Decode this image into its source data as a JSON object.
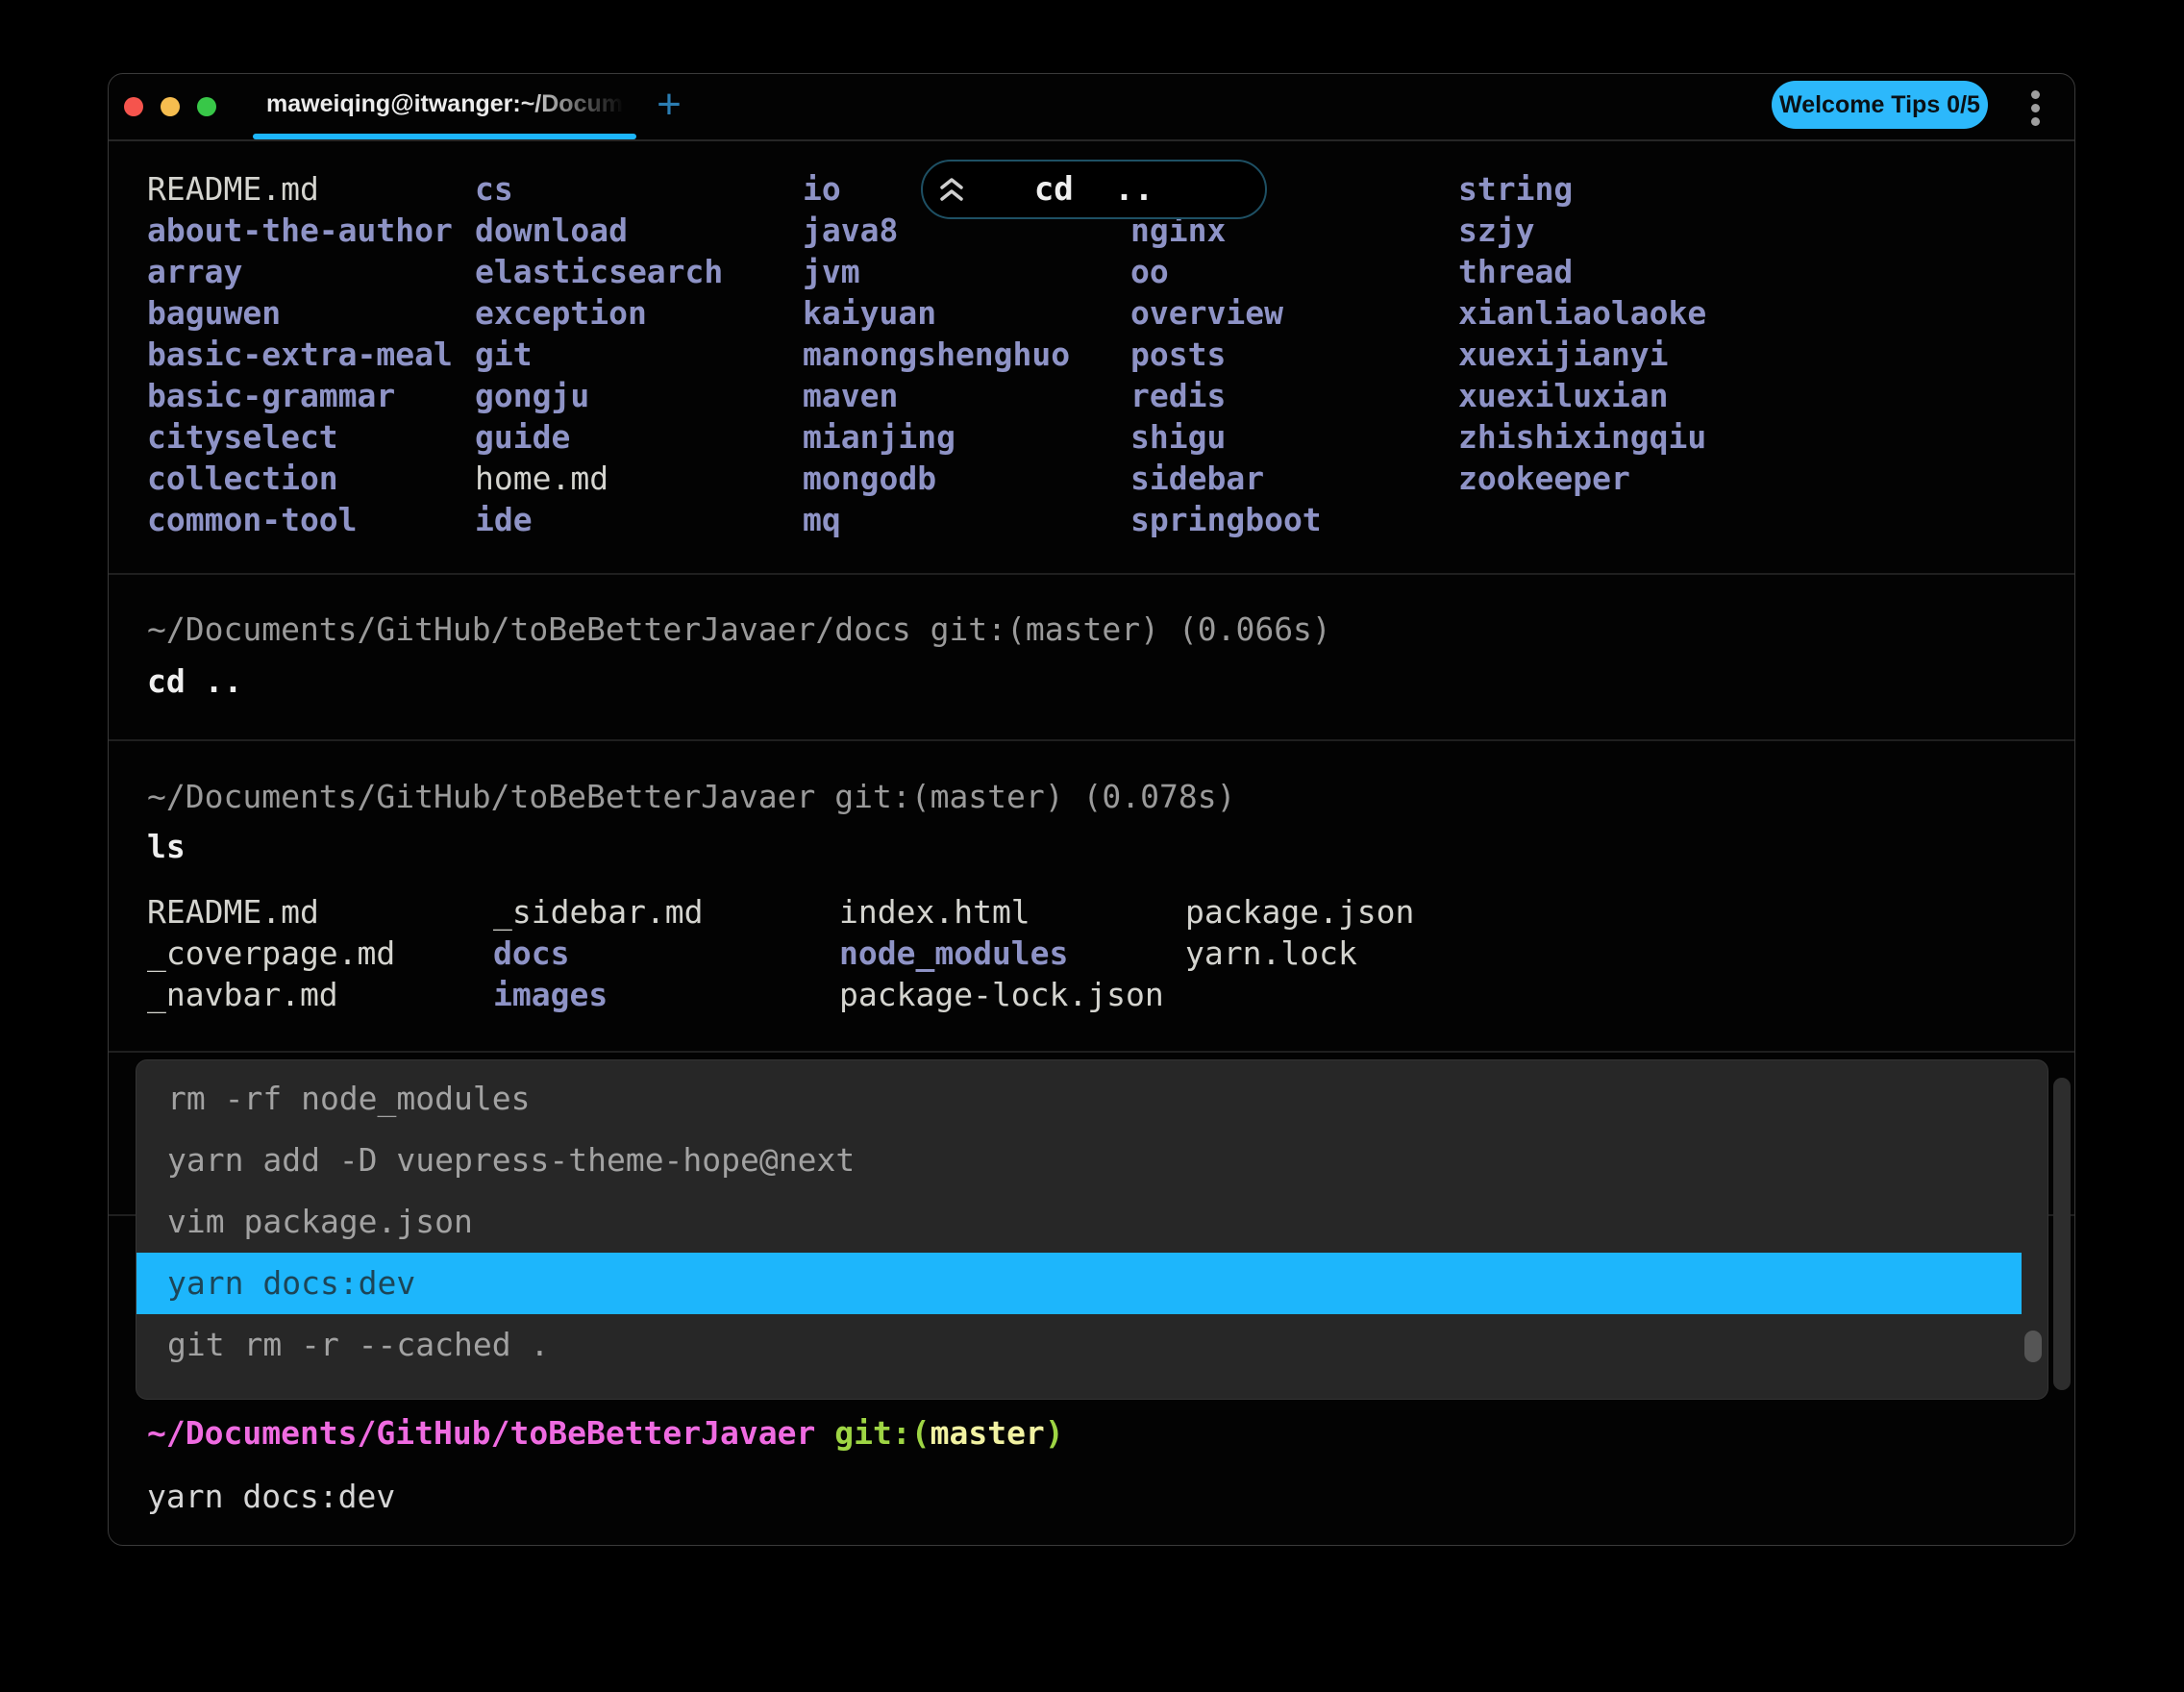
{
  "titlebar": {
    "tab_title": "maweiqing@itwanger:~/Docum",
    "new_tab_label": "+",
    "welcome_tips_label": "Welcome Tips 0/5"
  },
  "sticky_pill": {
    "command": "cd .."
  },
  "listing1": {
    "columns": [
      {
        "items": [
          {
            "t": "README.md",
            "k": "file"
          },
          {
            "t": "about-the-author",
            "k": "dir"
          },
          {
            "t": "array",
            "k": "dir"
          },
          {
            "t": "baguwen",
            "k": "dir"
          },
          {
            "t": "basic-extra-meal",
            "k": "dir"
          },
          {
            "t": "basic-grammar",
            "k": "dir"
          },
          {
            "t": "cityselect",
            "k": "dir"
          },
          {
            "t": "collection",
            "k": "dir"
          },
          {
            "t": "common-tool",
            "k": "dir"
          }
        ]
      },
      {
        "items": [
          {
            "t": "cs",
            "k": "dir"
          },
          {
            "t": "download",
            "k": "dir"
          },
          {
            "t": "elasticsearch",
            "k": "dir"
          },
          {
            "t": "exception",
            "k": "dir"
          },
          {
            "t": "git",
            "k": "dir"
          },
          {
            "t": "gongju",
            "k": "dir"
          },
          {
            "t": "guide",
            "k": "dir"
          },
          {
            "t": "home.md",
            "k": "file"
          },
          {
            "t": "ide",
            "k": "dir"
          }
        ]
      },
      {
        "items": [
          {
            "t": "io",
            "k": "dir"
          },
          {
            "t": "java8",
            "k": "dir"
          },
          {
            "t": "jvm",
            "k": "dir"
          },
          {
            "t": "kaiyuan",
            "k": "dir"
          },
          {
            "t": "manongshenghuo",
            "k": "dir"
          },
          {
            "t": "maven",
            "k": "dir"
          },
          {
            "t": "mianjing",
            "k": "dir"
          },
          {
            "t": "mongodb",
            "k": "dir"
          },
          {
            "t": "mq",
            "k": "dir"
          }
        ]
      },
      {
        "items": [
          {
            "t": "",
            "k": "hidden"
          },
          {
            "t": "nginx",
            "k": "dir"
          },
          {
            "t": "oo",
            "k": "dir"
          },
          {
            "t": "overview",
            "k": "dir"
          },
          {
            "t": "posts",
            "k": "dir"
          },
          {
            "t": "redis",
            "k": "dir"
          },
          {
            "t": "shigu",
            "k": "dir"
          },
          {
            "t": "sidebar",
            "k": "dir"
          },
          {
            "t": "springboot",
            "k": "dir"
          }
        ]
      },
      {
        "items": [
          {
            "t": "string",
            "k": "dir"
          },
          {
            "t": "szjy",
            "k": "dir"
          },
          {
            "t": "thread",
            "k": "dir"
          },
          {
            "t": "xianliaolaoke",
            "k": "dir"
          },
          {
            "t": "xuexijianyi",
            "k": "dir"
          },
          {
            "t": "xuexiluxian",
            "k": "dir"
          },
          {
            "t": "zhishixingqiu",
            "k": "dir"
          },
          {
            "t": "zookeeper",
            "k": "dir"
          }
        ]
      }
    ]
  },
  "block_cd": {
    "path_line": "~/Documents/GitHub/toBeBetterJavaer/docs git:(master) (0.066s)",
    "command": "cd .."
  },
  "block_ls": {
    "path_line": "~/Documents/GitHub/toBeBetterJavaer git:(master) (0.078s)",
    "command": "ls",
    "columns": [
      {
        "items": [
          {
            "t": "README.md",
            "k": "file"
          },
          {
            "t": "_coverpage.md",
            "k": "file"
          },
          {
            "t": "_navbar.md",
            "k": "file"
          }
        ]
      },
      {
        "items": [
          {
            "t": "_sidebar.md",
            "k": "file"
          },
          {
            "t": "docs",
            "k": "dir"
          },
          {
            "t": "images",
            "k": "dir"
          }
        ]
      },
      {
        "items": [
          {
            "t": "index.html",
            "k": "file"
          },
          {
            "t": "node_modules",
            "k": "dir"
          },
          {
            "t": "package-lock.json",
            "k": "file"
          }
        ]
      },
      {
        "items": [
          {
            "t": "package.json",
            "k": "file"
          },
          {
            "t": "yarn.lock",
            "k": "file"
          }
        ]
      }
    ]
  },
  "history_menu": {
    "items": [
      {
        "t": "rm -rf node_modules",
        "selected": false
      },
      {
        "t": "yarn add -D vuepress-theme-hope@next",
        "selected": false
      },
      {
        "t": "vim package.json",
        "selected": false
      },
      {
        "t": "yarn docs:dev",
        "selected": true
      },
      {
        "t": "git rm -r --cached .",
        "selected": false
      }
    ]
  },
  "prompt": {
    "path": "~/Documents/GitHub/toBeBetterJavaer",
    "git_open": " git:(",
    "branch": "master",
    "git_close": ")"
  },
  "input_line": {
    "value": "yarn docs:dev"
  },
  "colors": {
    "accent": "#1db6fc",
    "directory": "#8e93c6",
    "file": "#d4d4cf",
    "selection_bg": "#1db6fc",
    "prompt_path": "#ef6be1",
    "prompt_git": "#9ed544",
    "prompt_branch": "#f2f2a2"
  }
}
